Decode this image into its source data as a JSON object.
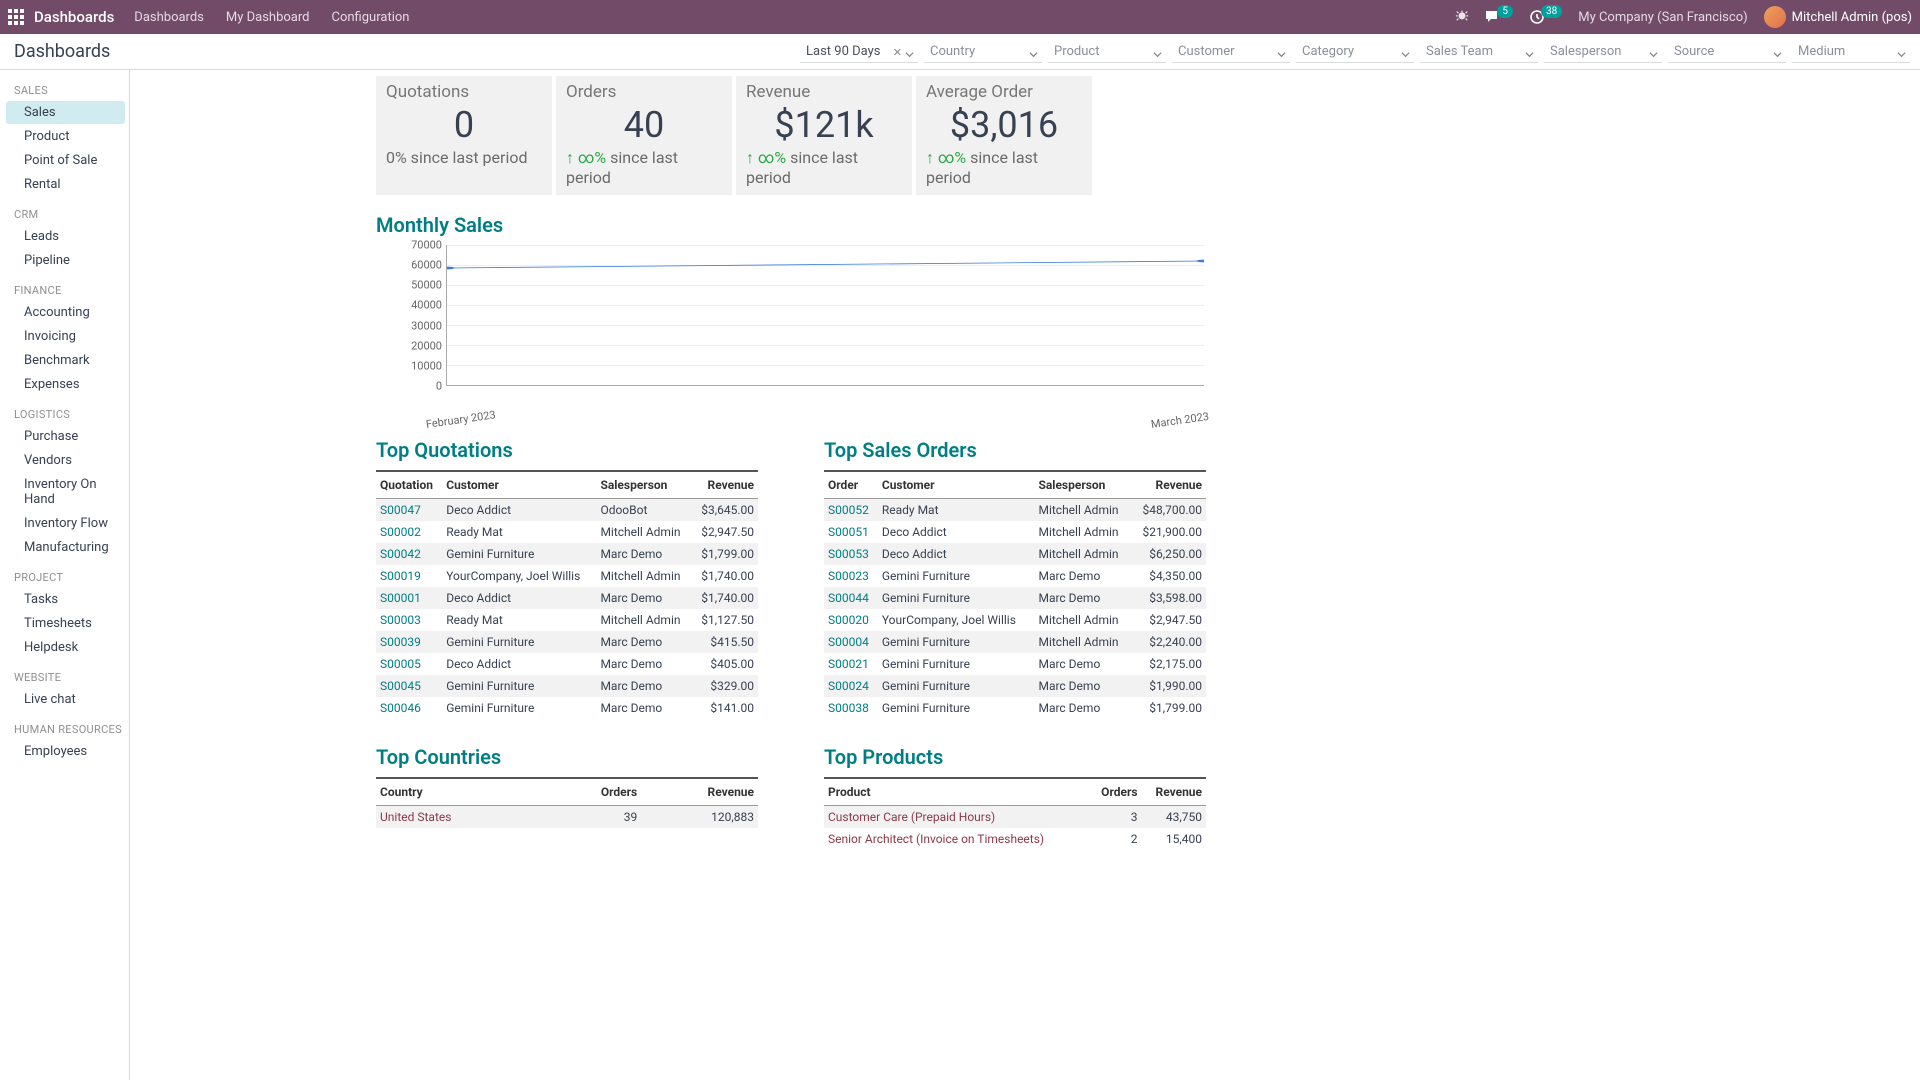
{
  "topbar": {
    "brand": "Dashboards",
    "nav": [
      "Dashboards",
      "My Dashboard",
      "Configuration"
    ],
    "msg_badge": "5",
    "clock_badge": "38",
    "company": "My Company (San Francisco)",
    "user": "Mitchell Admin (pos)"
  },
  "page_title": "Dashboards",
  "filters": {
    "period": "Last 90 Days",
    "list": [
      "Country",
      "Product",
      "Customer",
      "Category",
      "Sales Team",
      "Salesperson",
      "Source",
      "Medium"
    ]
  },
  "sidebar": [
    {
      "group": "SALES",
      "items": [
        "Sales",
        "Product",
        "Point of Sale",
        "Rental"
      ],
      "selected": "Sales"
    },
    {
      "group": "CRM",
      "items": [
        "Leads",
        "Pipeline"
      ]
    },
    {
      "group": "FINANCE",
      "items": [
        "Accounting",
        "Invoicing",
        "Benchmark",
        "Expenses"
      ]
    },
    {
      "group": "LOGISTICS",
      "items": [
        "Purchase",
        "Vendors",
        "Inventory On Hand",
        "Inventory Flow",
        "Manufacturing"
      ]
    },
    {
      "group": "PROJECT",
      "items": [
        "Tasks",
        "Timesheets",
        "Helpdesk"
      ]
    },
    {
      "group": "WEBSITE",
      "items": [
        "Live chat"
      ]
    },
    {
      "group": "HUMAN RESOURCES",
      "items": [
        "Employees"
      ]
    }
  ],
  "kpis": [
    {
      "label": "Quotations",
      "value": "0",
      "delta_prefix": "",
      "delta": "0% since last period",
      "up": false
    },
    {
      "label": "Orders",
      "value": "40",
      "delta_prefix": "↑",
      "delta": "∞% since last period",
      "up": true
    },
    {
      "label": "Revenue",
      "value": "$121k",
      "delta_prefix": "↑",
      "delta": "∞% since last period",
      "up": true
    },
    {
      "label": "Average Order",
      "value": "$3,016",
      "delta_prefix": "↑",
      "delta": "∞% since last period",
      "up": true
    }
  ],
  "chart_title": "Monthly Sales",
  "chart_data": {
    "type": "line",
    "x": [
      "February 2023",
      "March 2023"
    ],
    "values": [
      58500,
      62000
    ],
    "ylim": [
      0,
      70000
    ],
    "yticks": [
      0,
      10000,
      20000,
      30000,
      40000,
      50000,
      60000,
      70000
    ]
  },
  "top_quotations": {
    "title": "Top Quotations",
    "headers": [
      "Quotation",
      "Customer",
      "Salesperson",
      "Revenue"
    ],
    "rows": [
      [
        "S00047",
        "Deco Addict",
        "OdooBot",
        "$3,645.00"
      ],
      [
        "S00002",
        "Ready Mat",
        "Mitchell Admin",
        "$2,947.50"
      ],
      [
        "S00042",
        "Gemini Furniture",
        "Marc Demo",
        "$1,799.00"
      ],
      [
        "S00019",
        "YourCompany, Joel Willis",
        "Mitchell Admin",
        "$1,740.00"
      ],
      [
        "S00001",
        "Deco Addict",
        "Marc Demo",
        "$1,740.00"
      ],
      [
        "S00003",
        "Ready Mat",
        "Mitchell Admin",
        "$1,127.50"
      ],
      [
        "S00039",
        "Gemini Furniture",
        "Marc Demo",
        "$415.50"
      ],
      [
        "S00005",
        "Deco Addict",
        "Marc Demo",
        "$405.00"
      ],
      [
        "S00045",
        "Gemini Furniture",
        "Marc Demo",
        "$329.00"
      ],
      [
        "S00046",
        "Gemini Furniture",
        "Marc Demo",
        "$141.00"
      ]
    ]
  },
  "top_orders": {
    "title": "Top Sales Orders",
    "headers": [
      "Order",
      "Customer",
      "Salesperson",
      "Revenue"
    ],
    "rows": [
      [
        "S00052",
        "Ready Mat",
        "Mitchell Admin",
        "$48,700.00"
      ],
      [
        "S00051",
        "Deco Addict",
        "Mitchell Admin",
        "$21,900.00"
      ],
      [
        "S00053",
        "Deco Addict",
        "Mitchell Admin",
        "$6,250.00"
      ],
      [
        "S00023",
        "Gemini Furniture",
        "Marc Demo",
        "$4,350.00"
      ],
      [
        "S00044",
        "Gemini Furniture",
        "Marc Demo",
        "$3,598.00"
      ],
      [
        "S00020",
        "YourCompany, Joel Willis",
        "Mitchell Admin",
        "$2,947.50"
      ],
      [
        "S00004",
        "Gemini Furniture",
        "Mitchell Admin",
        "$2,240.00"
      ],
      [
        "S00021",
        "Gemini Furniture",
        "Marc Demo",
        "$2,175.00"
      ],
      [
        "S00024",
        "Gemini Furniture",
        "Marc Demo",
        "$1,990.00"
      ],
      [
        "S00038",
        "Gemini Furniture",
        "Marc Demo",
        "$1,799.00"
      ]
    ]
  },
  "top_countries": {
    "title": "Top Countries",
    "headers": [
      "Country",
      "Orders",
      "Revenue"
    ],
    "rows": [
      [
        "United States",
        "39",
        "120,883"
      ]
    ]
  },
  "top_products": {
    "title": "Top Products",
    "headers": [
      "Product",
      "Orders",
      "Revenue"
    ],
    "rows": [
      [
        "Customer Care (Prepaid Hours)",
        "3",
        "43,750"
      ],
      [
        "Senior Architect (Invoice on Timesheets)",
        "2",
        "15,400"
      ]
    ]
  }
}
